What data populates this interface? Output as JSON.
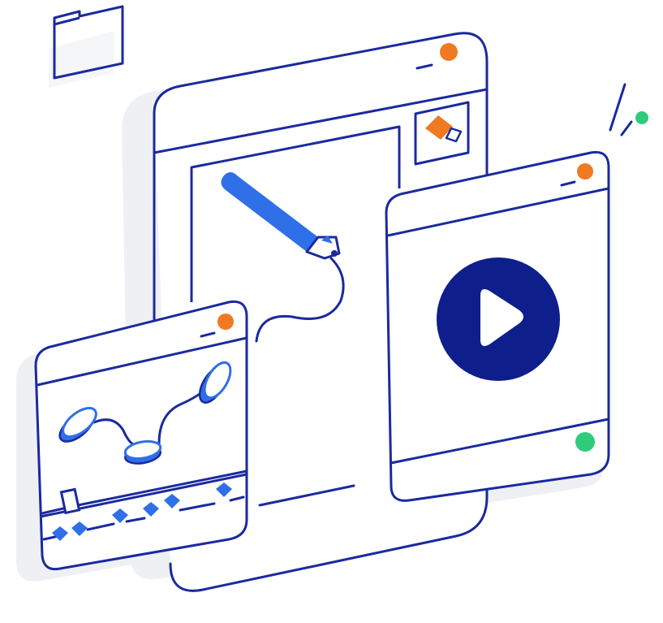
{
  "illustration": {
    "subject": "media-editing",
    "colors": {
      "outline": "#1a2a9e",
      "accent_blue": "#2f6fe8",
      "play_circle": "#0e1f8c",
      "orange": "#f07a21",
      "green": "#2ecc7a",
      "shadow": "#eff0f3",
      "background": "#ffffff"
    },
    "icons": [
      "folder-icon",
      "pencil-icon",
      "play-icon",
      "image-thumbnail-icon",
      "disc-keyframe-icon",
      "timeline-diamond-icon"
    ]
  }
}
